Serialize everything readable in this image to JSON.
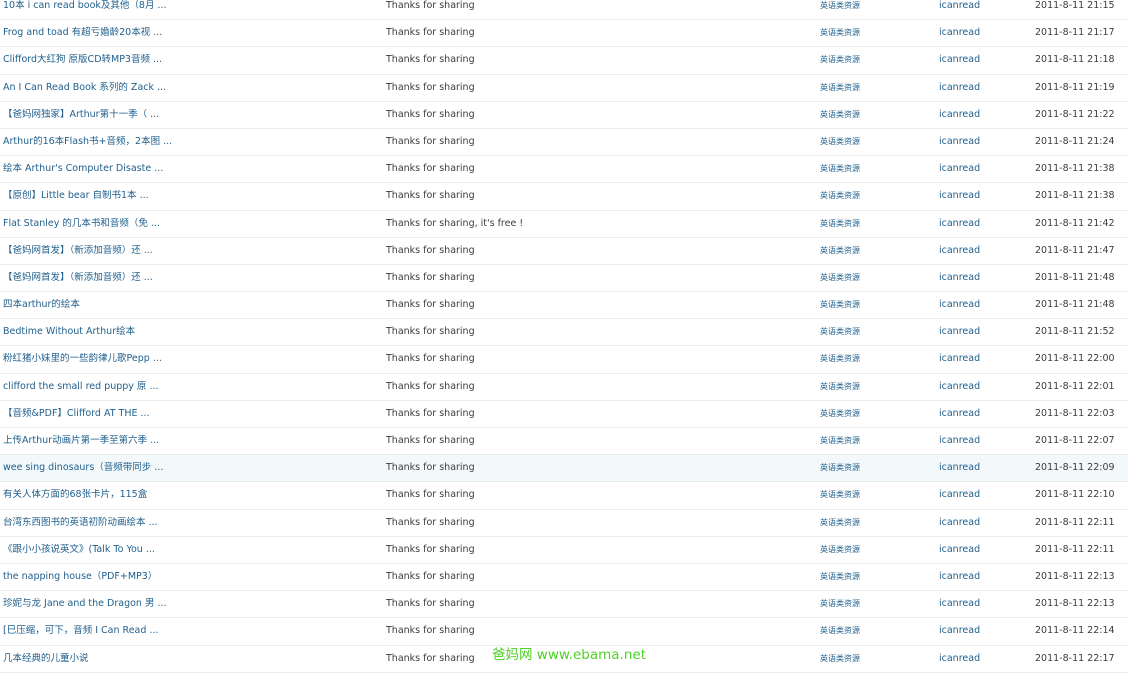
{
  "rows": [
    {
      "title": "10本 i can read book及其他（8月 ...",
      "reply": "Thanks for sharing",
      "forum": "英语类资源",
      "author": "icanread",
      "date": "2011-8-11 21:15"
    },
    {
      "title": "Frog and toad 有超亏婚龄20本视 ...",
      "reply": "Thanks for sharing",
      "forum": "英语类资源",
      "author": "icanread",
      "date": "2011-8-11 21:17"
    },
    {
      "title": "Clifford大红狗 原版CD转MP3音频 ...",
      "reply": "Thanks for sharing",
      "forum": "英语类资源",
      "author": "icanread",
      "date": "2011-8-11 21:18"
    },
    {
      "title": "An I Can Read Book 系列的 Zack ...",
      "reply": "Thanks for sharing",
      "forum": "英语类资源",
      "author": "icanread",
      "date": "2011-8-11 21:19"
    },
    {
      "title": "【爸妈网独家】Arthur第十一季（ ...",
      "reply": "Thanks for sharing",
      "forum": "英语类资源",
      "author": "icanread",
      "date": "2011-8-11 21:22"
    },
    {
      "title": "Arthur的16本Flash书+音频，2本图 ...",
      "reply": "Thanks for sharing",
      "forum": "英语类资源",
      "author": "icanread",
      "date": "2011-8-11 21:24"
    },
    {
      "title": "绘本 Arthur's Computer Disaste ...",
      "reply": "Thanks for sharing",
      "forum": "英语类资源",
      "author": "icanread",
      "date": "2011-8-11 21:38"
    },
    {
      "title": "【原创】Little bear 自制书1本 ...",
      "reply": "Thanks for sharing",
      "forum": "英语类资源",
      "author": "icanread",
      "date": "2011-8-11 21:38"
    },
    {
      "title": "Flat Stanley 的几本书和音频（免 ...",
      "reply": "Thanks for sharing, it's free !",
      "forum": "英语类资源",
      "author": "icanread",
      "date": "2011-8-11 21:42"
    },
    {
      "title": "【爸妈网首发】（新添加音频）还 ...",
      "reply": "Thanks for sharing",
      "forum": "英语类资源",
      "author": "icanread",
      "date": "2011-8-11 21:47"
    },
    {
      "title": "【爸妈网首发】（新添加音频）还 ...",
      "reply": "Thanks for sharing",
      "forum": "英语类资源",
      "author": "icanread",
      "date": "2011-8-11 21:48"
    },
    {
      "title": "四本arthur的绘本",
      "reply": "Thanks for sharing",
      "forum": "英语类资源",
      "author": "icanread",
      "date": "2011-8-11 21:48"
    },
    {
      "title": "Bedtime Without Arthur绘本",
      "reply": "Thanks for sharing",
      "forum": "英语类资源",
      "author": "icanread",
      "date": "2011-8-11 21:52"
    },
    {
      "title": "粉红猪小妹里的一些韵律儿歌Pepp ...",
      "reply": "Thanks for sharing",
      "forum": "英语类资源",
      "author": "icanread",
      "date": "2011-8-11 22:00"
    },
    {
      "title": "clifford the small red puppy 原 ...",
      "reply": "Thanks for sharing",
      "forum": "英语类资源",
      "author": "icanread",
      "date": "2011-8-11 22:01"
    },
    {
      "title": "【音频&PDF】Clifford AT THE ...",
      "reply": "Thanks for sharing",
      "forum": "英语类资源",
      "author": "icanread",
      "date": "2011-8-11 22:03"
    },
    {
      "title": "上传Arthur动画片第一季至第六季 ...",
      "reply": "Thanks for sharing",
      "forum": "英语类资源",
      "author": "icanread",
      "date": "2011-8-11 22:07"
    },
    {
      "title": "wee sing dinosaurs（音频带同步 ...",
      "reply": "Thanks for sharing",
      "forum": "英语类资源",
      "author": "icanread",
      "date": "2011-8-11 22:09"
    },
    {
      "title": "有关人体方面的68张卡片，115盒",
      "reply": "Thanks for sharing",
      "forum": "英语类资源",
      "author": "icanread",
      "date": "2011-8-11 22:10"
    },
    {
      "title": "台湾东西图书的英语初阶动画绘本 ...",
      "reply": "Thanks for sharing",
      "forum": "英语类资源",
      "author": "icanread",
      "date": "2011-8-11 22:11"
    },
    {
      "title": "《跟小小孩说英文》(Talk To You ...",
      "reply": "Thanks for sharing",
      "forum": "英语类资源",
      "author": "icanread",
      "date": "2011-8-11 22:11"
    },
    {
      "title": "the napping house（PDF+MP3）",
      "reply": "Thanks for sharing",
      "forum": "英语类资源",
      "author": "icanread",
      "date": "2011-8-11 22:13"
    },
    {
      "title": "珍妮与龙 Jane and the Dragon 男 ...",
      "reply": "Thanks for sharing",
      "forum": "英语类资源",
      "author": "icanread",
      "date": "2011-8-11 22:13"
    },
    {
      "title": "[巳压缩，可下，音频 I Can Read ...",
      "reply": "Thanks for sharing",
      "forum": "英语类资源",
      "author": "icanread",
      "date": "2011-8-11 22:14"
    },
    {
      "title": "几本经典的儿童小说",
      "reply": "Thanks for sharing",
      "forum": "英语类资源",
      "author": "icanread",
      "date": "2011-8-11 22:17"
    }
  ],
  "highlighted_row": 17,
  "watermark": "爸妈网 www.ebama.net",
  "colors": {
    "link": "#1f5f8c",
    "text": "#3c3c3c",
    "row_border": "#e6ecf0",
    "row_highlight": "#f3f8fb",
    "watermark": "#4fd126"
  }
}
